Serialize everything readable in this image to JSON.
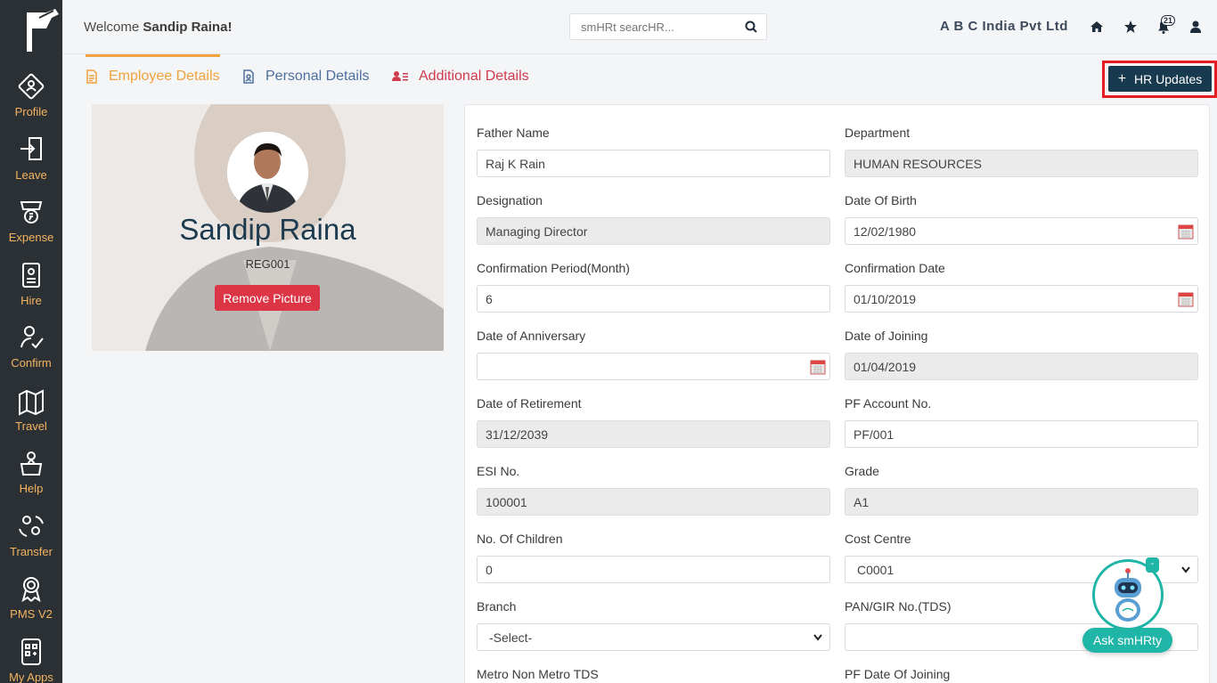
{
  "header": {
    "welcome_prefix": "Welcome",
    "user_name": "Sandip Raina!",
    "search_placeholder": "smHRt searcHR...",
    "company": "A B C India Pvt Ltd",
    "notification_count": "21"
  },
  "sidebar": {
    "items": [
      {
        "label": "Profile",
        "icon": "profile-icon"
      },
      {
        "label": "Leave",
        "icon": "leave-icon"
      },
      {
        "label": "Expense",
        "icon": "expense-icon"
      },
      {
        "label": "Hire",
        "icon": "hire-icon"
      },
      {
        "label": "Confirm",
        "icon": "confirm-icon"
      },
      {
        "label": "Travel",
        "icon": "travel-icon"
      },
      {
        "label": "Help",
        "icon": "help-icon"
      },
      {
        "label": "Transfer",
        "icon": "transfer-icon"
      },
      {
        "label": "PMS V2",
        "icon": "pms-icon"
      },
      {
        "label": "My Apps",
        "icon": "apps-icon"
      }
    ]
  },
  "tabs": {
    "employee": "Employee Details",
    "personal": "Personal Details",
    "additional": "Additional Details"
  },
  "hr_updates_label": "HR Updates",
  "profile": {
    "name": "Sandip Raina",
    "code": "REG001",
    "remove_label": "Remove Picture"
  },
  "form": {
    "father_name": {
      "label": "Father Name",
      "value": "Raj K Rain"
    },
    "department": {
      "label": "Department",
      "value": "HUMAN RESOURCES"
    },
    "designation": {
      "label": "Designation",
      "value": "Managing Director"
    },
    "dob": {
      "label": "Date Of Birth",
      "value": "12/02/1980"
    },
    "conf_period": {
      "label": "Confirmation Period(Month)",
      "value": "6"
    },
    "conf_date": {
      "label": "Confirmation Date",
      "value": "01/10/2019"
    },
    "anniversary": {
      "label": "Date of Anniversary",
      "value": ""
    },
    "joining": {
      "label": "Date of Joining",
      "value": "01/04/2019"
    },
    "retirement": {
      "label": "Date of Retirement",
      "value": "31/12/2039"
    },
    "pf_account": {
      "label": "PF Account No.",
      "value": "PF/001"
    },
    "esi": {
      "label": "ESI No.",
      "value": "100001"
    },
    "grade": {
      "label": "Grade",
      "value": "A1"
    },
    "children": {
      "label": "No. Of Children",
      "value": "0"
    },
    "cost_centre": {
      "label": "Cost Centre",
      "value": "C0001"
    },
    "branch": {
      "label": "Branch",
      "value": "-Select-"
    },
    "pan": {
      "label": "PAN/GIR No.(TDS)",
      "value": ""
    },
    "metro": {
      "label": "Metro Non Metro TDS"
    },
    "pf_joining": {
      "label": "PF Date Of Joining"
    }
  },
  "bot": {
    "label": "Ask smHRty",
    "minimize": "-"
  },
  "colors": {
    "sidebar_bg": "#2b3035",
    "sidebar_text": "#f4b45f",
    "primary_button": "#173a4f",
    "danger_button": "#dc3545",
    "bot_accent": "#1fb5a7"
  }
}
